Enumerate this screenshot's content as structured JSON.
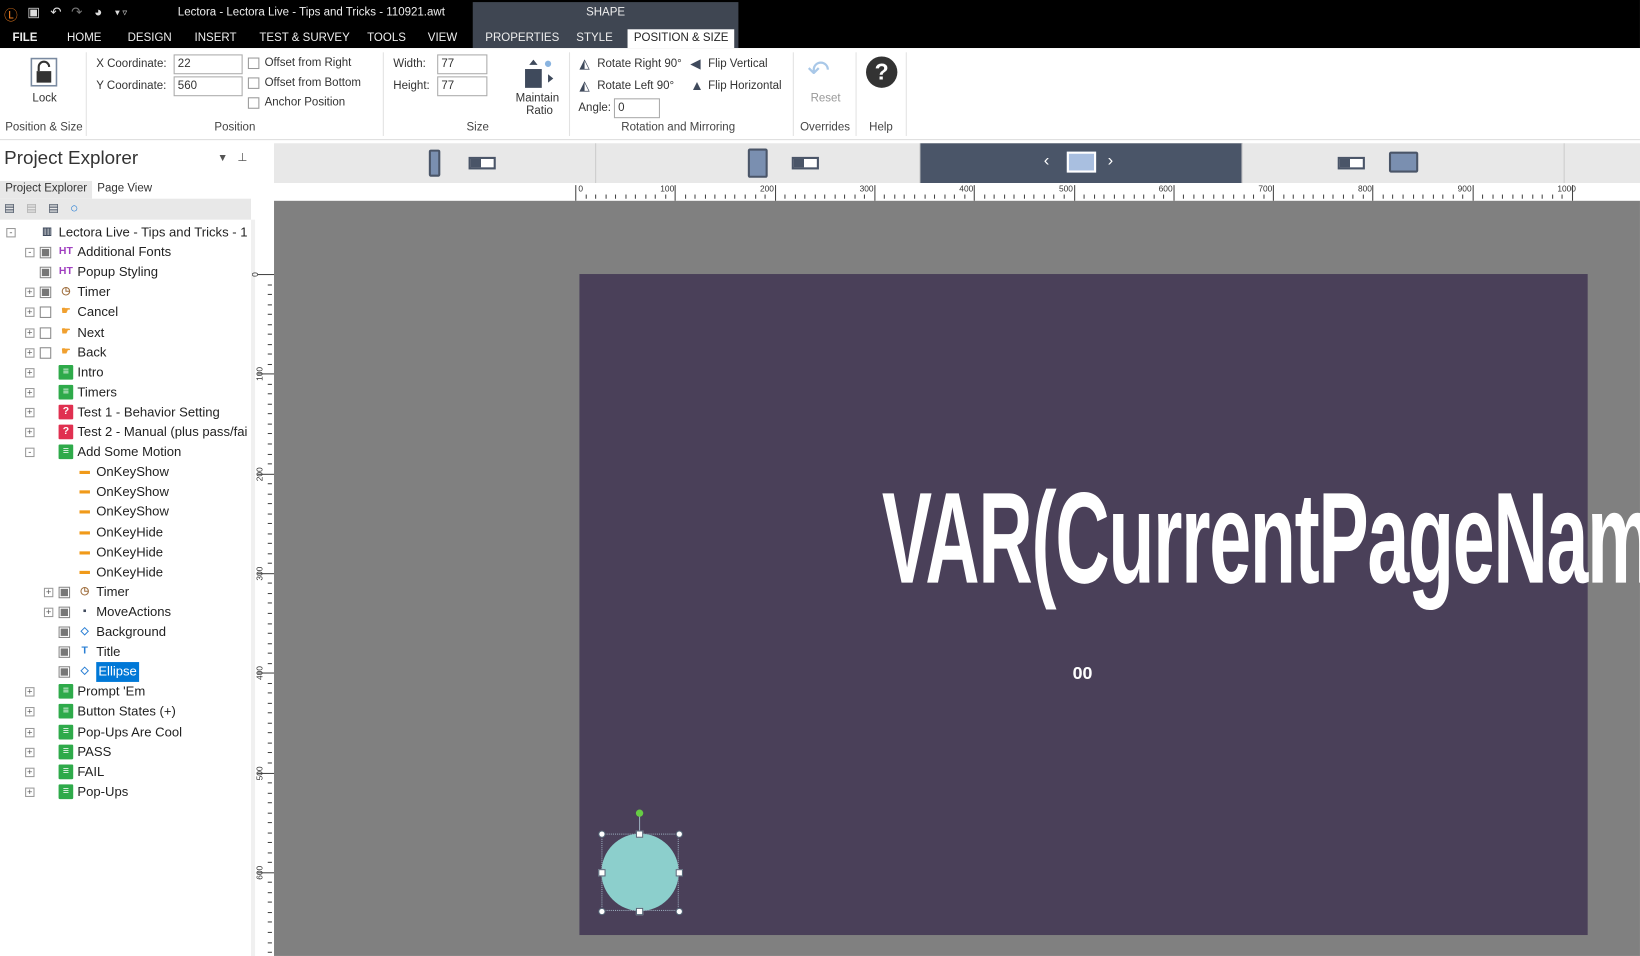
{
  "app": {
    "title": "Lectora - Lectora Live - Tips and Tricks - 110921.awt",
    "context_tab": "SHAPE"
  },
  "menu_tabs": [
    "FILE",
    "HOME",
    "DESIGN",
    "INSERT",
    "TEST & SURVEY",
    "TOOLS",
    "VIEW",
    "PROPERTIES",
    "STYLE",
    "POSITION & SIZE"
  ],
  "active_tab": "POSITION & SIZE",
  "ribbon": {
    "lock": "Lock",
    "group_pos_size": "Position & Size",
    "x_label": "X Coordinate:",
    "x_value": "22",
    "y_label": "Y Coordinate:",
    "y_value": "560",
    "offset_right": "Offset from Right",
    "offset_bottom": "Offset from Bottom",
    "anchor": "Anchor Position",
    "group_position": "Position",
    "width_label": "Width:",
    "width_value": "77",
    "height_label": "Height:",
    "height_value": "77",
    "maintain": "Maintain",
    "ratio": "Ratio",
    "group_size": "Size",
    "rot_right": "Rotate Right 90°",
    "rot_left": "Rotate Left 90°",
    "flip_v": "Flip Vertical",
    "flip_h": "Flip Horizontal",
    "angle_label": "Angle:",
    "angle_value": "0",
    "group_rot": "Rotation and Mirroring",
    "reset": "Reset",
    "group_overrides": "Overrides",
    "group_help": "Help"
  },
  "explorer": {
    "title": "Project Explorer",
    "tabs": [
      "Project Explorer",
      "Page View"
    ],
    "items": [
      {
        "label": "Lectora Live - Tips and Tricks - 1",
        "level": 0,
        "exp": "-",
        "chk": false,
        "icon": "title"
      },
      {
        "label": "Additional Fonts",
        "level": 1,
        "exp": "-",
        "chk": "g",
        "icon": "html"
      },
      {
        "label": "Popup Styling",
        "level": 1,
        "exp": "",
        "chk": "g",
        "icon": "html"
      },
      {
        "label": "Timer",
        "level": 1,
        "exp": "+",
        "chk": "g",
        "icon": "timer"
      },
      {
        "label": "Cancel",
        "level": 1,
        "exp": "+",
        "chk": "w",
        "icon": "button"
      },
      {
        "label": "Next",
        "level": 1,
        "exp": "+",
        "chk": "w",
        "icon": "button"
      },
      {
        "label": "Back",
        "level": 1,
        "exp": "+",
        "chk": "w",
        "icon": "button"
      },
      {
        "label": "Intro",
        "level": 1,
        "exp": "+",
        "chk": false,
        "icon": "page"
      },
      {
        "label": "Timers",
        "level": 1,
        "exp": "+",
        "chk": false,
        "icon": "page"
      },
      {
        "label": "Test 1 - Behavior Setting",
        "level": 1,
        "exp": "+",
        "chk": false,
        "icon": "test"
      },
      {
        "label": "Test 2 - Manual (plus pass/fai",
        "level": 1,
        "exp": "+",
        "chk": false,
        "icon": "test"
      },
      {
        "label": "Add Some Motion",
        "level": 1,
        "exp": "-",
        "chk": false,
        "icon": "page"
      },
      {
        "label": "OnKeyShow",
        "level": 2,
        "exp": "",
        "chk": false,
        "icon": "action"
      },
      {
        "label": "OnKeyShow",
        "level": 2,
        "exp": "",
        "chk": false,
        "icon": "action"
      },
      {
        "label": "OnKeyShow",
        "level": 2,
        "exp": "",
        "chk": false,
        "icon": "action"
      },
      {
        "label": "OnKeyHide",
        "level": 2,
        "exp": "",
        "chk": false,
        "icon": "action"
      },
      {
        "label": "OnKeyHide",
        "level": 2,
        "exp": "",
        "chk": false,
        "icon": "action"
      },
      {
        "label": "OnKeyHide",
        "level": 2,
        "exp": "",
        "chk": false,
        "icon": "action"
      },
      {
        "label": "Timer",
        "level": 2,
        "exp": "+",
        "chk": "g",
        "icon": "timer"
      },
      {
        "label": "MoveActions",
        "level": 2,
        "exp": "+",
        "chk": "g",
        "icon": "group"
      },
      {
        "label": "Background",
        "level": 2,
        "exp": "",
        "chk": "g",
        "icon": "shape"
      },
      {
        "label": "Title",
        "level": 2,
        "exp": "",
        "chk": "g",
        "icon": "text"
      },
      {
        "label": "Ellipse",
        "level": 2,
        "exp": "",
        "chk": "g",
        "icon": "shape",
        "selected": true
      },
      {
        "label": "Prompt 'Em",
        "level": 1,
        "exp": "+",
        "chk": false,
        "icon": "page"
      },
      {
        "label": "Button States (+)",
        "level": 1,
        "exp": "+",
        "chk": false,
        "icon": "page"
      },
      {
        "label": "Pop-Ups Are Cool",
        "level": 1,
        "exp": "+",
        "chk": false,
        "icon": "page"
      },
      {
        "label": "PASS",
        "level": 1,
        "exp": "+",
        "chk": false,
        "icon": "page"
      },
      {
        "label": "FAIL",
        "level": 1,
        "exp": "+",
        "chk": false,
        "icon": "page"
      },
      {
        "label": "Pop-Ups",
        "level": 1,
        "exp": "+",
        "chk": false,
        "icon": "page"
      }
    ]
  },
  "canvas": {
    "page_text": "VAR(CurrentPageName)",
    "timer_text": "00",
    "page_color": "#4a4059",
    "ellipse_color": "#8ccfcc",
    "ruler_labels": [
      "0",
      "100",
      "200",
      "300",
      "400",
      "500",
      "600",
      "700",
      "800",
      "900",
      "1000"
    ],
    "vruler_labels": [
      "0",
      "100",
      "200",
      "300",
      "400",
      "500",
      "600"
    ]
  },
  "colors": {
    "accent": "#0078d7",
    "device_active": "#4a5568"
  }
}
